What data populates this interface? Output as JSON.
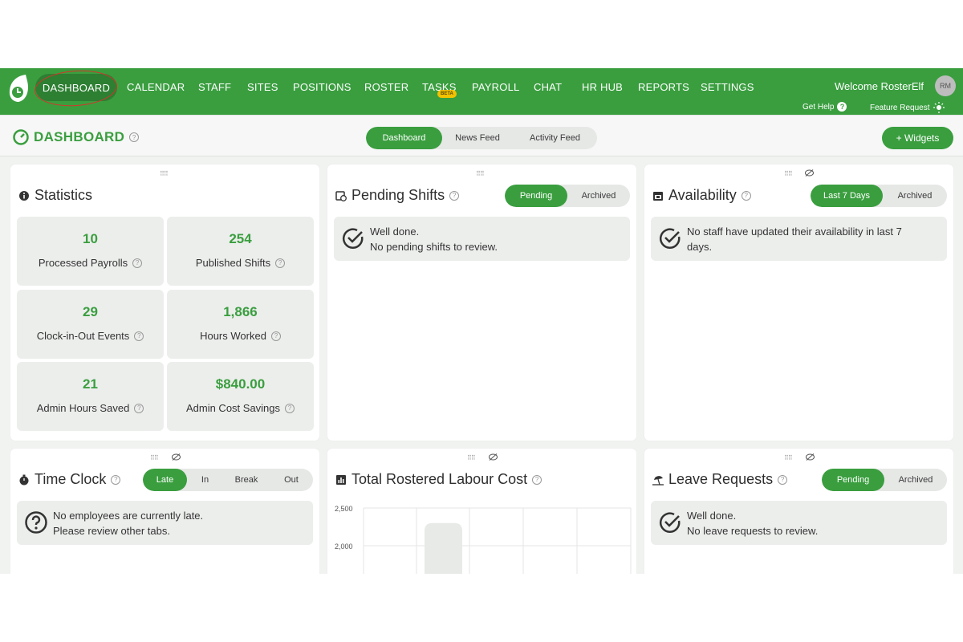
{
  "nav": {
    "items": [
      "DASHBOARD",
      "CALENDAR",
      "STAFF",
      "SITES",
      "POSITIONS",
      "ROSTER",
      "TASKS",
      "PAYROLL",
      "CHAT",
      "HR HUB",
      "REPORTS",
      "SETTINGS"
    ],
    "beta": "BETA",
    "welcome": "Welcome RosterElf",
    "avatar": "RM",
    "get_help": "Get Help",
    "feature_request": "Feature Request"
  },
  "header": {
    "title": "DASHBOARD",
    "tabs": [
      "Dashboard",
      "News Feed",
      "Activity Feed"
    ],
    "widgets_button": "+ Widgets"
  },
  "statistics": {
    "title": "Statistics",
    "items": [
      {
        "value": "10",
        "label": "Processed Payrolls"
      },
      {
        "value": "254",
        "label": "Published Shifts"
      },
      {
        "value": "29",
        "label": "Clock-in-Out Events"
      },
      {
        "value": "1,866",
        "label": "Hours Worked"
      },
      {
        "value": "21",
        "label": "Admin Hours Saved"
      },
      {
        "value": "$840.00",
        "label": "Admin Cost Savings"
      }
    ]
  },
  "pending_shifts": {
    "title": "Pending Shifts",
    "tabs": [
      "Pending",
      "Archived"
    ],
    "message_line1": "Well done.",
    "message_line2": "No pending shifts to review."
  },
  "availability": {
    "title": "Availability",
    "tabs": [
      "Last 7 Days",
      "Archived"
    ],
    "message_line1": "No staff have updated their availability in last 7",
    "message_line2": "days."
  },
  "time_clock": {
    "title": "Time Clock",
    "tabs": [
      "Late",
      "In",
      "Break",
      "Out"
    ],
    "message_line1": "No employees are currently late.",
    "message_line2": "Please review other tabs."
  },
  "labour_cost": {
    "title": "Total Rostered Labour Cost",
    "y_ticks": [
      "2,500",
      "2,000"
    ]
  },
  "leave_requests": {
    "title": "Leave Requests",
    "tabs": [
      "Pending",
      "Archived"
    ],
    "message_line1": "Well done.",
    "message_line2": "No leave requests to review."
  },
  "colors": {
    "brand_green": "#3a9e3f",
    "dark_green": "#2d7f32",
    "annotation_red": "#d8322a"
  },
  "chart_data": {
    "type": "bar",
    "title": "Total Rostered Labour Cost",
    "y_ticks": [
      2500,
      2000
    ],
    "ylim_visible": [
      1750,
      2600
    ],
    "values_visible": [
      2300
    ],
    "grid": true
  }
}
